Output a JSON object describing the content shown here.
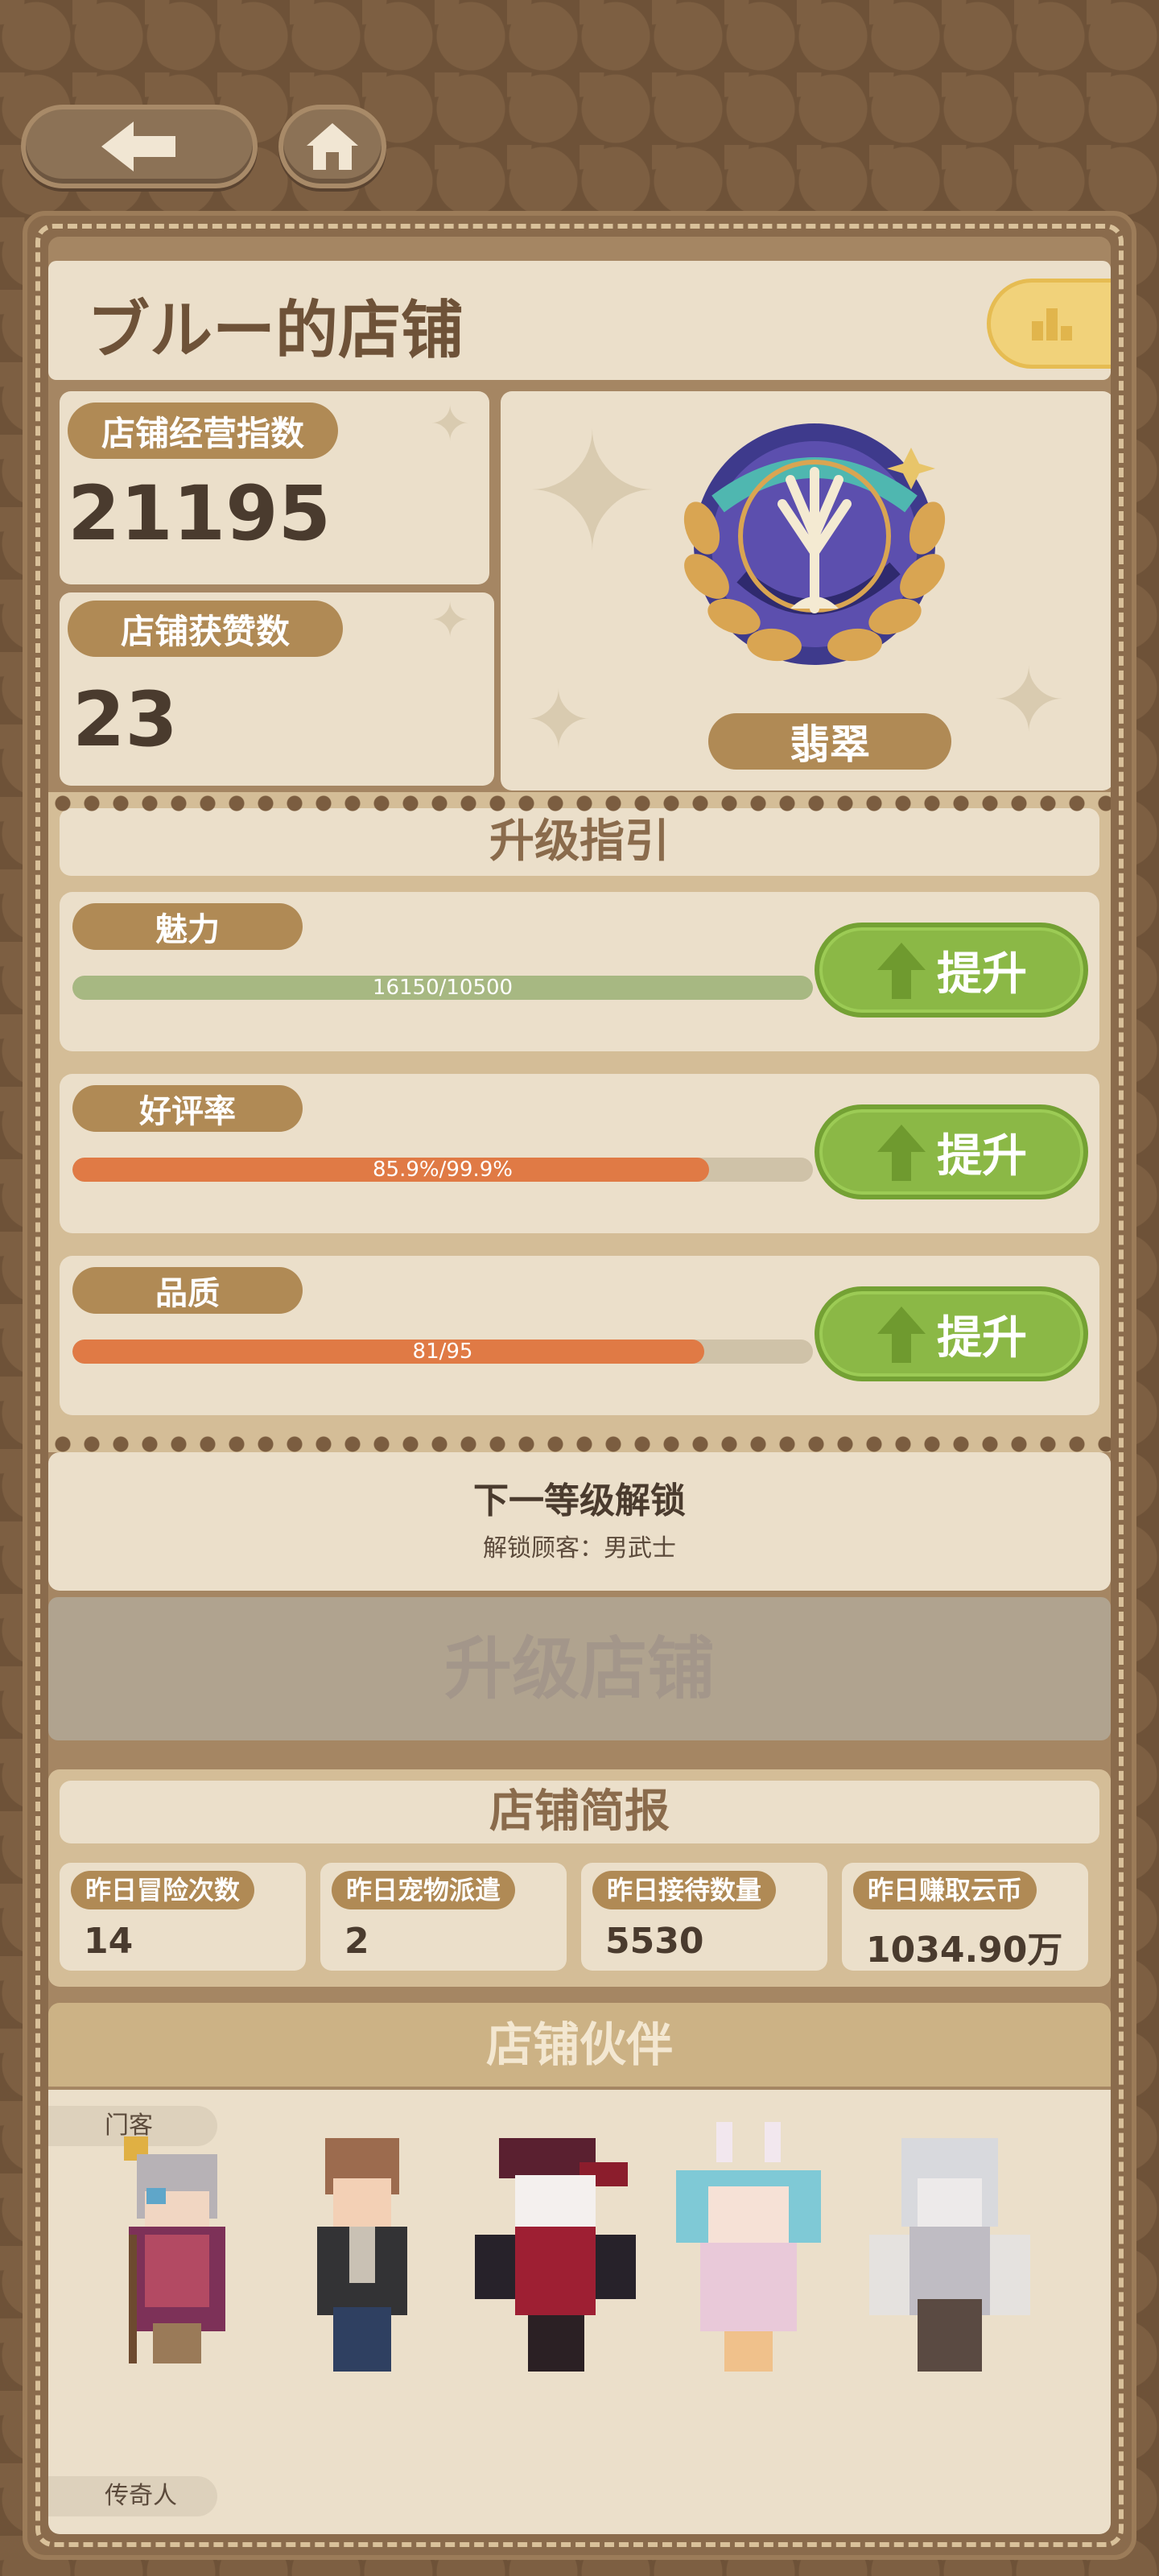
{
  "nav": {
    "back_icon": "arrow-left-icon",
    "home_icon": "home-icon"
  },
  "shop": {
    "title": "ブルー的店铺",
    "rank_icon": "bar-chart-icon"
  },
  "stats": {
    "index_label": "店铺经营指数",
    "index_value": "21195",
    "likes_label": "店铺获赞数",
    "likes_value": "23"
  },
  "badge": {
    "icon": "laurel-tree-emblem-icon",
    "tier": "翡翠"
  },
  "guide": {
    "title": "升级指引",
    "rows": [
      {
        "label": "魅力",
        "progress_text": "16150/10500",
        "fill": 1.0,
        "color": "#a7b882",
        "button": "提升"
      },
      {
        "label": "好评率",
        "progress_text": "85.9%/99.9%",
        "fill": 0.86,
        "color": "#e07a45",
        "button": "提升"
      },
      {
        "label": "品质",
        "progress_text": "81/95",
        "fill": 0.853,
        "color": "#e07a45",
        "button": "提升"
      }
    ]
  },
  "unlock": {
    "title": "下一等级解锁",
    "subtitle": "解锁顾客：男武士"
  },
  "upgrade_button": "升级店铺",
  "report": {
    "title": "店铺简报",
    "items": [
      {
        "label": "昨日冒险次数",
        "value": "14"
      },
      {
        "label": "昨日宠物派遣",
        "value": "2"
      },
      {
        "label": "昨日接待数量",
        "value": "5530"
      },
      {
        "label": "昨日赚取云币",
        "value": "1034.90万"
      }
    ]
  },
  "partners": {
    "title": "店铺伙伴",
    "tag_top": "门客",
    "tag_bottom": "传奇人",
    "characters": [
      "elder-mage-sprite",
      "brown-hair-boy-sprite",
      "red-witch-sprite",
      "blue-bunny-girl-sprite",
      "white-hair-elf-sprite"
    ]
  }
}
